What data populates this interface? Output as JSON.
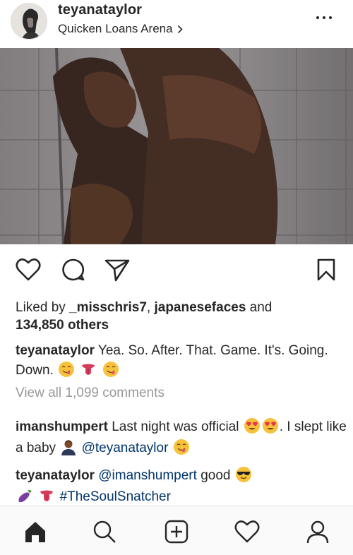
{
  "header": {
    "username": "teyanataylor",
    "location": "Quicken Loans Arena",
    "location_chevron_icon": "chevron-right-icon",
    "more_icon": "more-horizontal-icon"
  },
  "actions": {
    "like_icon": "heart-outline-icon",
    "comment_icon": "comment-bubble-icon",
    "share_icon": "paper-plane-icon",
    "save_icon": "bookmark-icon"
  },
  "likes": {
    "prefix": "Liked by ",
    "user1": "_misschris7",
    "separator": ", ",
    "user2": "japanesefaces",
    "and_text": " and",
    "others": "134,850 others"
  },
  "caption": {
    "username": "teyanataylor",
    "text": "Yea. So. After. That. Game. It's. Going. Down."
  },
  "view_all_comments": "View all 1,099 comments",
  "comments": [
    {
      "username": "imanshumpert",
      "text_part1": "Last night was official",
      "text_part2": ". I slept like a baby",
      "mention": "@teyanataylor"
    },
    {
      "username": "teyanataylor",
      "mention": "@imanshumpert",
      "text": "good",
      "hashtag": "#TheSoulSnatcher"
    }
  ],
  "nav": {
    "home_icon": "home-icon",
    "search_icon": "search-icon",
    "add_icon": "add-post-icon",
    "activity_icon": "heart-outline-icon",
    "profile_icon": "profile-icon"
  },
  "colors": {
    "text": "#262626",
    "muted": "#999999",
    "link": "#003569",
    "divider": "#dbdbdb",
    "nav_bg": "#fafafa"
  }
}
